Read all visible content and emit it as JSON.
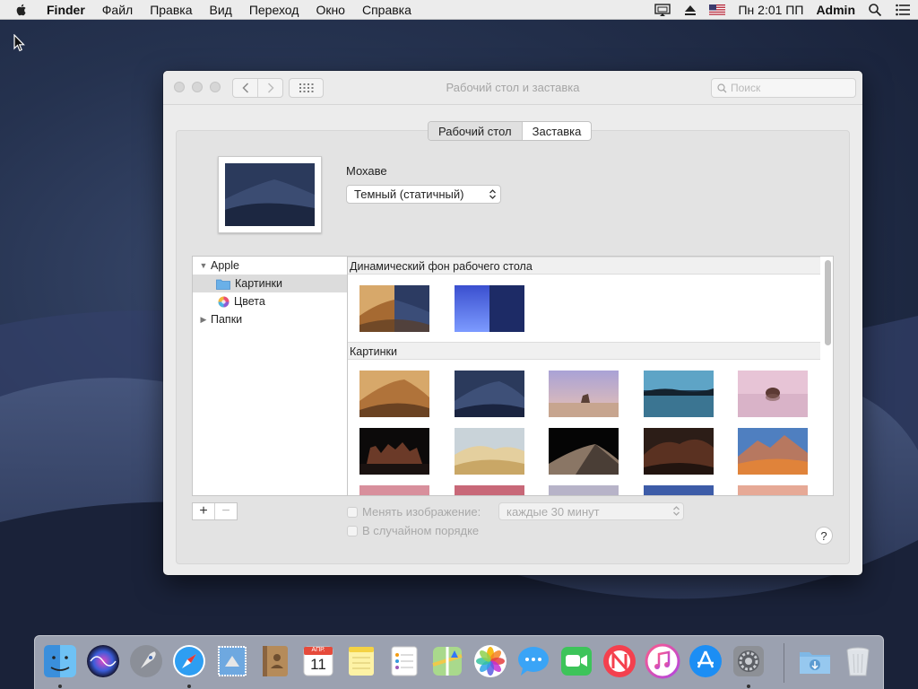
{
  "menubar": {
    "app_name": "Finder",
    "menus": [
      "Файл",
      "Правка",
      "Вид",
      "Переход",
      "Окно",
      "Справка"
    ],
    "clock": "Пн 2:01 ПП",
    "user": "Admin",
    "icons": [
      "apple-icon",
      "display-mirror-icon",
      "eject-icon",
      "us-flag-icon",
      "spotlight-icon",
      "notification-center-icon"
    ]
  },
  "window": {
    "title": "Рабочий стол и заставка",
    "search_placeholder": "Поиск",
    "tabs": [
      {
        "label": "Рабочий стол",
        "active": true
      },
      {
        "label": "Заставка",
        "active": false
      }
    ],
    "wallpaper_name": "Мохаве",
    "style_value": "Темный (статичный)",
    "sources": {
      "apple": "Apple",
      "pictures": "Картинки",
      "colors": "Цвета",
      "folders": "Папки"
    },
    "sections": {
      "dynamic": "Динамический фон рабочего стола",
      "pictures": "Картинки"
    },
    "change_picture_label": "Менять изображение:",
    "interval_value": "каждые 30 минут",
    "random_order_label": "В случайном порядке",
    "help_label": "?",
    "add_label": "+",
    "remove_label": "−"
  },
  "dock": {
    "items": [
      "Finder",
      "Siri",
      "Launchpad",
      "Safari",
      "Mail",
      "Contacts",
      "Calendar",
      "Notes",
      "Reminders",
      "Maps",
      "Photos",
      "Messages",
      "FaceTime",
      "News",
      "iTunes",
      "App Store",
      "System Preferences"
    ],
    "calendar_month": "АПР.",
    "calendar_day": "11"
  },
  "colors": {
    "desktop_dark": "#1c2540",
    "accent_blue": "#3b8ef0",
    "folder_blue": "#6ab0e8"
  }
}
